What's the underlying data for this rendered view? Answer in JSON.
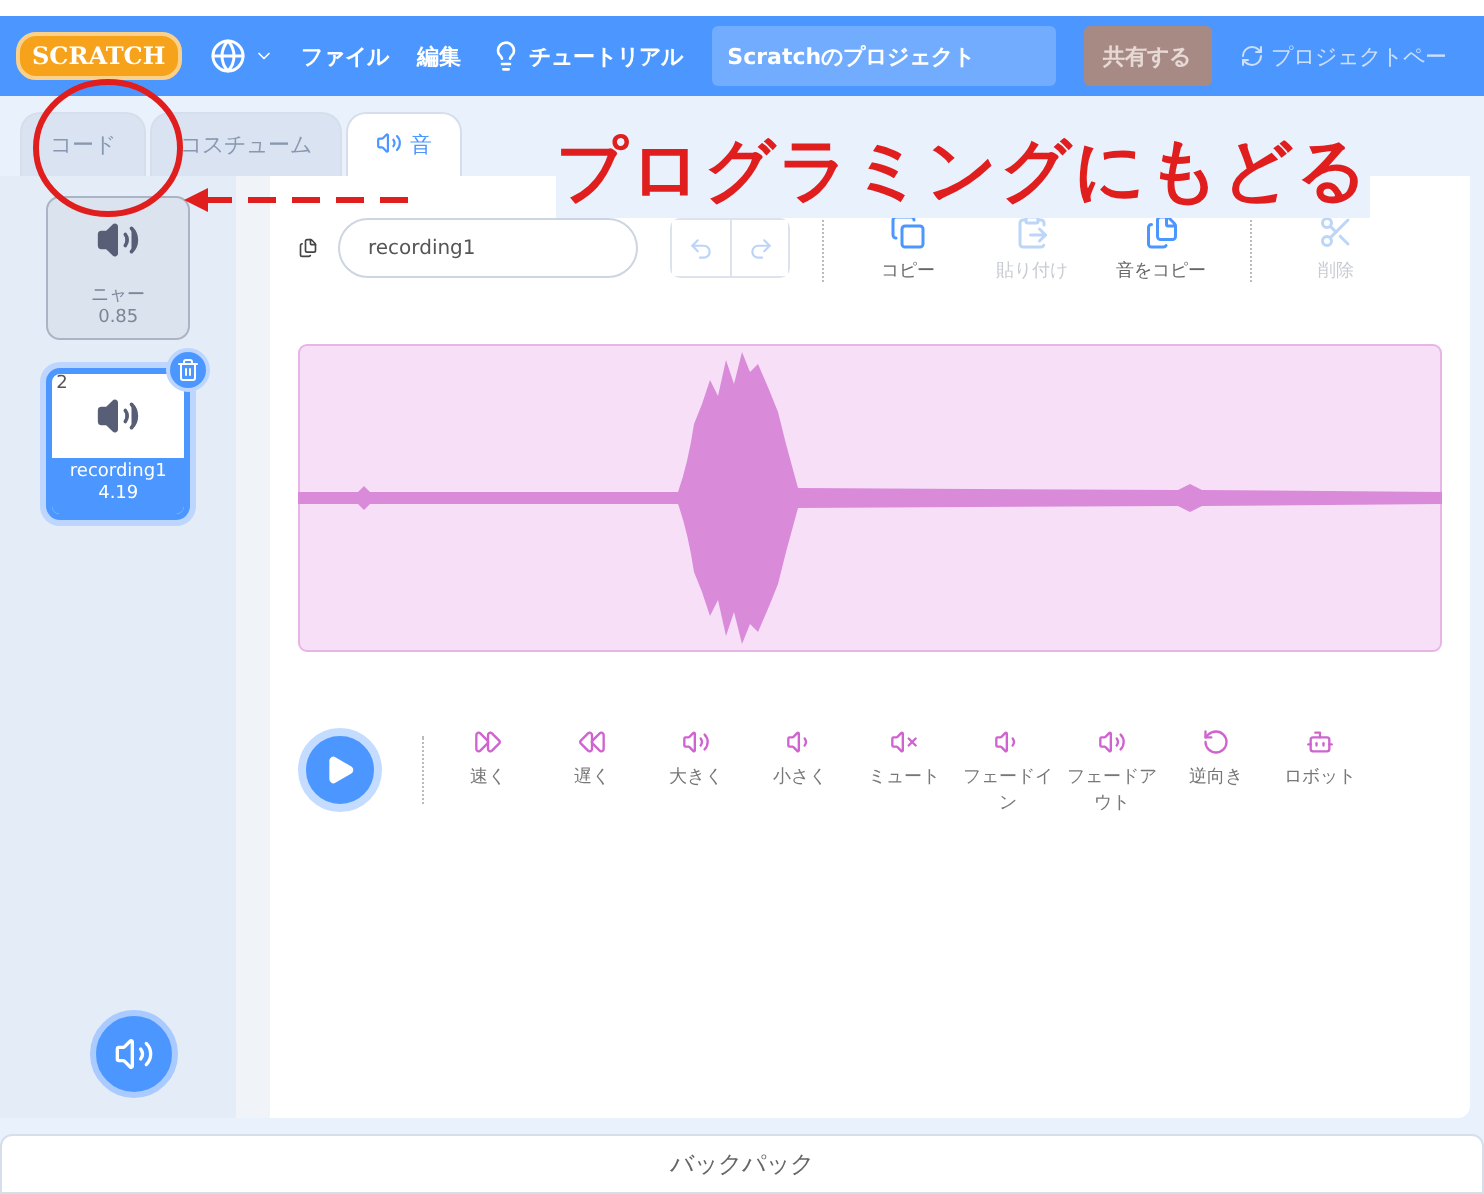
{
  "menu_bar": {
    "logo": "SCRATCH",
    "items": [
      "ファイル",
      "編集"
    ],
    "tutorial": "チュートリアル",
    "project_title": "Scratchのプロジェクト",
    "share_button": "共有する",
    "project_page": "プロジェクトペー"
  },
  "tabs": [
    {
      "label": "コード",
      "selected": false
    },
    {
      "label": "コスチューム",
      "selected": false
    },
    {
      "label": "音",
      "selected": true
    }
  ],
  "annotation": {
    "text": "プログラミングにもどる"
  },
  "sounds": [
    {
      "name": "ニャー",
      "duration": "0.85",
      "selected": false
    },
    {
      "number": "2",
      "name": "recording1",
      "duration": "4.19",
      "selected": true
    }
  ],
  "editor": {
    "sound_name": "recording1",
    "tools": [
      {
        "label": "コピー",
        "disabled": false
      },
      {
        "label": "貼り付け",
        "disabled": true
      },
      {
        "label": "音をコピー",
        "disabled": false
      },
      {
        "label": "削除",
        "disabled": true
      }
    ],
    "effects": [
      "速く",
      "遅く",
      "大きく",
      "小さく",
      "ミュート",
      "フェードイン",
      "フェードアウト",
      "逆向き",
      "ロボット"
    ]
  },
  "backpack": "バックパック"
}
